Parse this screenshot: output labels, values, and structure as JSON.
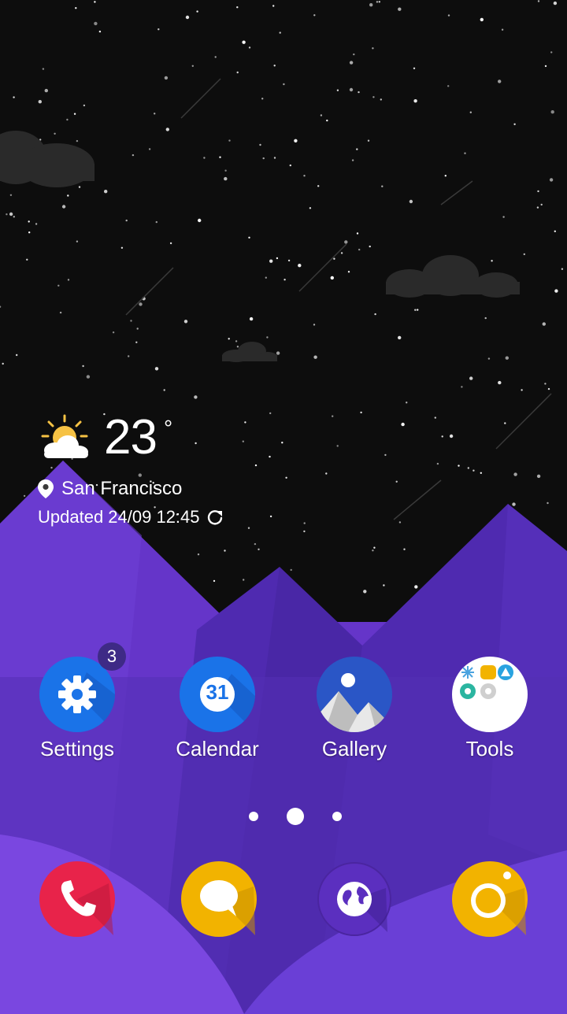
{
  "weather": {
    "temperature": "23",
    "degree_symbol": "°",
    "location": "San Francisco",
    "updated": "Updated 24/09 12:45",
    "icon": "partly-sunny-icon"
  },
  "apps": [
    {
      "label": "Settings",
      "icon": "gear-icon",
      "color": "#1a73e8",
      "badge": "3"
    },
    {
      "label": "Calendar",
      "icon": "calendar-icon",
      "color": "#1a73e8",
      "day": "31"
    },
    {
      "label": "Gallery",
      "icon": "gallery-icon",
      "color": "#2a56c6"
    },
    {
      "label": "Tools",
      "icon": "tools-folder-icon",
      "color": "#ffffff"
    }
  ],
  "page_indicator": {
    "pages": 3,
    "current": 2
  },
  "dock": [
    {
      "icon": "phone-icon",
      "color": "#e8234a"
    },
    {
      "icon": "messages-icon",
      "color": "#f2b300"
    },
    {
      "icon": "browser-globe-icon",
      "color": "#5b2fbf"
    },
    {
      "icon": "camera-icon",
      "color": "#f2b300"
    }
  ],
  "colors": {
    "sky": "#0d0d0d",
    "mountain_light": "#6a3fd0",
    "mountain_dark": "#4b2aa3"
  }
}
